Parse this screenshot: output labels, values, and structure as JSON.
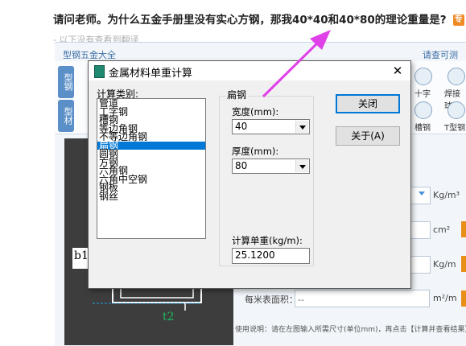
{
  "question": {
    "text": "请问老师。为什么五金手册里没有实心方钢，那我40*40和40*80的理论重量是?",
    "badge": "专",
    "subtext": "- 以下没有查看到翻译"
  },
  "background_app": {
    "title": "型钢五金大全",
    "feedback": "请查可测",
    "side_tabs": [
      "型钢",
      "型材"
    ],
    "ribbon_labels": [
      "十字",
      "焊接球",
      "槽钢",
      "T型钢"
    ],
    "units": [
      "Kg/m³",
      "cm²",
      "Kg/m",
      "m²/m"
    ],
    "surface_label": "每米表面积：",
    "surface_value": "--",
    "help_text": "使用说明：请在左图输入所需尺寸(单位mm)，再点击【计算并查看结果】",
    "drawing_labels": {
      "b1": "b1",
      "t2": "t2"
    }
  },
  "dialog": {
    "title": "金属材料单重计算",
    "close_glyph": "✕",
    "category_label": "计算类别:",
    "categories": [
      "管道",
      "工字钢",
      "槽钢",
      "等边角钢",
      "不等边角钢",
      "扁钢",
      "圆钢",
      "方钢",
      "六角钢",
      "六角中空钢",
      "钢板",
      "钢丝"
    ],
    "selected_index": 5,
    "group_title": "扁钢",
    "width_label": "宽度(mm):",
    "width_value": "40",
    "thickness_label": "厚度(mm):",
    "thickness_value": "80",
    "result_label": "计算单重(kg/m):",
    "result_value": "25.1200",
    "close_button": "关闭",
    "about_button": "关于(A)"
  },
  "colors": {
    "arrow": "#e040e8",
    "selection": "#0078d7",
    "accent": "#e88f19"
  }
}
